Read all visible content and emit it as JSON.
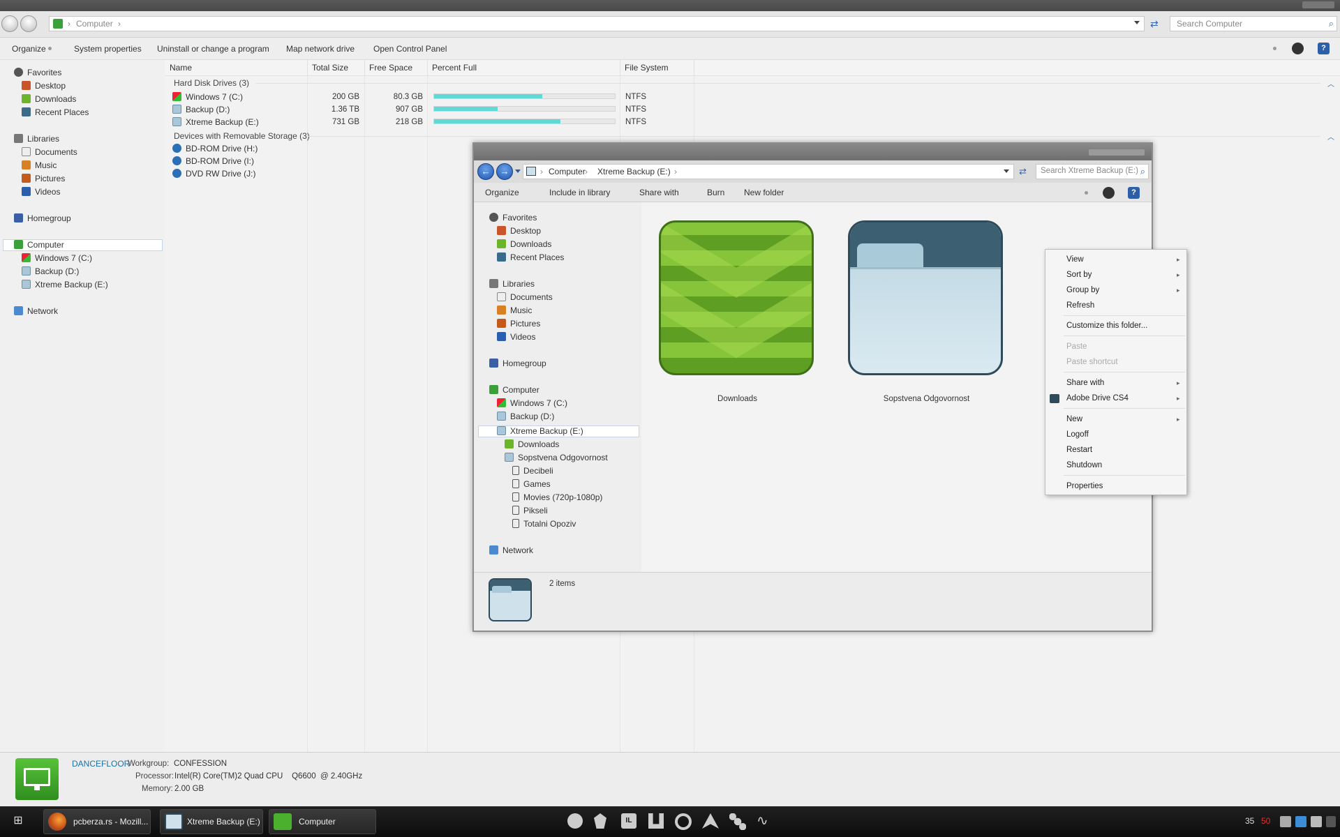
{
  "window": {
    "address": {
      "root": "Computer",
      "sep": "›"
    },
    "search_placeholder": "Search Computer",
    "commands": [
      "Organize",
      "System properties",
      "Uninstall or change a program",
      "Map network drive",
      "Open Control Panel"
    ],
    "help": "?"
  },
  "nav": {
    "favorites": "Favorites",
    "desktop": "Desktop",
    "downloads": "Downloads",
    "recent": "Recent Places",
    "libraries": "Libraries",
    "documents": "Documents",
    "music": "Music",
    "pictures": "Pictures",
    "videos": "Videos",
    "homegroup": "Homegroup",
    "computer": "Computer",
    "drive_c": "Windows 7 (C:)",
    "drive_d": "Backup (D:)",
    "drive_e": "Xtreme Backup (E:)",
    "network": "Network"
  },
  "columns": [
    "Name",
    "Total Size",
    "Free Space",
    "Percent Full",
    "File System"
  ],
  "groups": {
    "hdd": "Hard Disk Drives (3)",
    "removable": "Devices with Removable Storage (3)"
  },
  "drives": [
    {
      "name": "Windows 7 (C:)",
      "total": "200 GB",
      "free": "80.3 GB",
      "percent_full": 0.6,
      "fs": "NTFS"
    },
    {
      "name": "Backup (D:)",
      "total": "1.36 TB",
      "free": "907 GB",
      "percent_full": 0.35,
      "fs": "NTFS"
    },
    {
      "name": "Xtreme Backup (E:)",
      "total": "731 GB",
      "free": "218 GB",
      "percent_full": 0.7,
      "fs": "NTFS"
    }
  ],
  "removable": [
    "BD-ROM Drive (H:)",
    "BD-ROM Drive (I:)",
    "DVD RW Drive (J:)"
  ],
  "details": {
    "name": "DANCEFLOOR",
    "workgroup_label": "Workgroup:",
    "workgroup": "CONFESSION",
    "processor_label": "Processor:",
    "processor": "Intel(R) Core(TM)2 Quad CPU    Q6600  @ 2.40GHz",
    "memory_label": "Memory:",
    "memory": "2.00 GB"
  },
  "taskbar": {
    "buttons": [
      "pcberza.rs - Mozill...",
      "Xtreme Backup (E:)",
      "Computer"
    ],
    "tray": {
      "num1": "35",
      "num2": "50"
    }
  },
  "win2": {
    "address": {
      "root": "Computer",
      "current": "Xtreme Backup (E:)",
      "sep": "›"
    },
    "search_placeholder": "Search Xtreme Backup (E:)",
    "commands": [
      "Organize",
      "Include in library",
      "Share with",
      "Burn",
      "New folder"
    ],
    "help": "?",
    "nav": {
      "favorites": "Favorites",
      "desktop": "Desktop",
      "downloads": "Downloads",
      "recent": "Recent Places",
      "libraries": "Libraries",
      "documents": "Documents",
      "music": "Music",
      "pictures": "Pictures",
      "videos": "Videos",
      "homegroup": "Homegroup",
      "computer": "Computer",
      "drive_c": "Windows 7 (C:)",
      "drive_d": "Backup (D:)",
      "drive_e": "Xtreme Backup (E:)",
      "sub_downloads": "Downloads",
      "sub_folder": "Sopstvena Odgovornost",
      "f1": "Decibeli",
      "f2": "Games",
      "f3": "Movies (720p-1080p)",
      "f4": "Pikseli",
      "f5": "Totalni Opoziv",
      "network": "Network"
    },
    "items": [
      "Downloads",
      "Sopstvena Odgovornost"
    ],
    "status": "2 items"
  },
  "context_menu": {
    "view": "View",
    "sort": "Sort by",
    "group": "Group by",
    "refresh": "Refresh",
    "customize": "Customize this folder...",
    "paste": "Paste",
    "paste_shortcut": "Paste shortcut",
    "share": "Share with",
    "adobe": "Adobe Drive CS4",
    "new": "New",
    "logoff": "Logoff",
    "restart": "Restart",
    "shutdown": "Shutdown",
    "properties": "Properties",
    "arrow": "▸"
  }
}
